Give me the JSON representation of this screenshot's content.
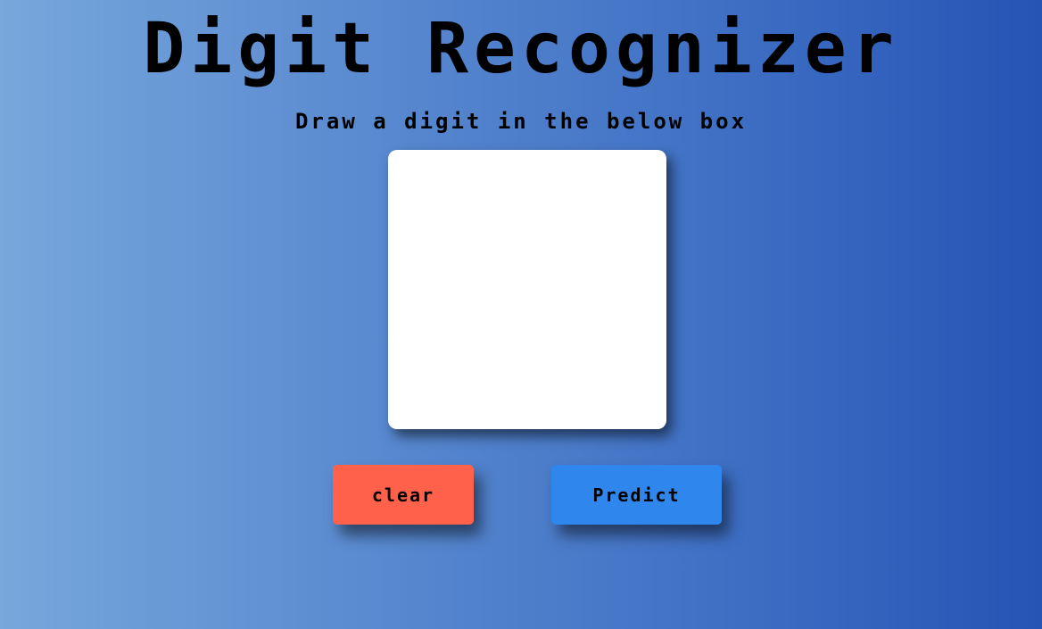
{
  "header": {
    "title": "Digit Recognizer",
    "subtitle": "Draw a digit in the below box"
  },
  "canvas": {
    "background": "#ffffff"
  },
  "buttons": {
    "clear": {
      "label": "clear",
      "color": "#ff614a"
    },
    "predict": {
      "label": "Predict",
      "color": "#2f86ec"
    }
  },
  "theme": {
    "gradient_start": "#77a7db",
    "gradient_end": "#2554b5",
    "text_color": "#000000"
  }
}
